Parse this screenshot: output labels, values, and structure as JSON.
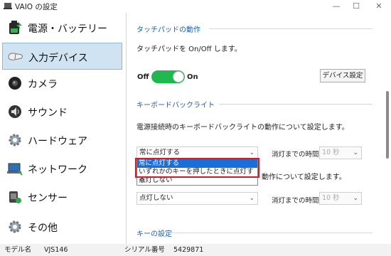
{
  "window": {
    "title": "VAIO の設定",
    "minimize": "—",
    "maximize": "☐",
    "close": "✕"
  },
  "sidebar": {
    "items": [
      {
        "label": "電源・バッテリー",
        "icon": "battery-icon"
      },
      {
        "label": "入力デバイス",
        "icon": "mouse-icon",
        "active": true
      },
      {
        "label": "カメラ",
        "icon": "camera-icon"
      },
      {
        "label": "サウンド",
        "icon": "speaker-icon"
      },
      {
        "label": "ハードウェア",
        "icon": "gear-icon"
      },
      {
        "label": "ネットワーク",
        "icon": "network-icon"
      },
      {
        "label": "センサー",
        "icon": "sensor-icon"
      },
      {
        "label": "その他",
        "icon": "gear-icon"
      }
    ]
  },
  "touchpad": {
    "section_title": "タッチパッドの動作",
    "description": "タッチパッドを On/Off します。",
    "toggle_off_label": "Off",
    "toggle_on_label": "On",
    "toggle_state": true,
    "device_settings_button": "デバイス設定"
  },
  "keyboard_backlight": {
    "section_title": "キーボードバックライト",
    "description_ac": "電源接続時のキーボードバックライトの動作について設定します。",
    "select_ac_value": "常に点灯する",
    "timeout_label_ac": "消灯までの時間:",
    "timeout_value_ac": "10 秒",
    "description_battery_partial": "動作について設定します。",
    "select_battery_value": "点灯しない",
    "timeout_label_battery": "消灯までの時間:",
    "timeout_value_battery": "10 秒",
    "dropdown_options": [
      "常に点灯する",
      "いずれかのキーを押したときに点灯する",
      "点灯しない"
    ]
  },
  "key_settings": {
    "section_title": "キーの設定"
  },
  "statusbar": {
    "model_label": "モデル名",
    "model_value": "VJS146",
    "serial_label": "シリアル番号",
    "serial_value": "5429871"
  },
  "colors": {
    "accent": "#1f5fa8",
    "toggle_on": "#1fb84f",
    "highlight": "#d7192c",
    "selection": "#1a6fd6"
  }
}
